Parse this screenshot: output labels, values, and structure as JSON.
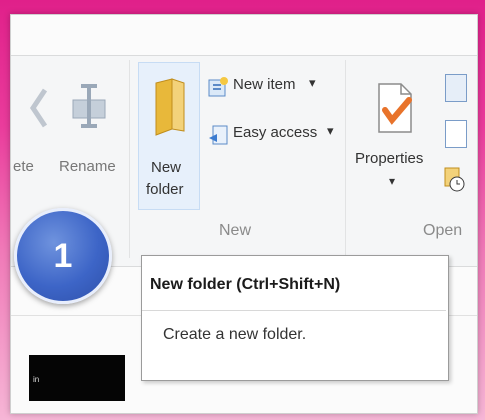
{
  "ribbon": {
    "delete_label": "ete",
    "rename_label": "Rename",
    "new_folder_label_line1": "New",
    "new_folder_label_line2": "folder",
    "new_item_label": "New item",
    "easy_access_label": "Easy access",
    "dropdown_caret": "▾",
    "properties_label": "Properties",
    "group_new_label": "New",
    "group_open_label": "Open"
  },
  "tooltip": {
    "title": "New folder (Ctrl+Shift+N)",
    "description": "Create a new folder."
  },
  "step_badge": "1",
  "black_box_text": "in",
  "colors": {
    "background_gradient_top": "#e0208a",
    "badge_blue": "#3d65c7",
    "checkmark_orange": "#e8732b",
    "folder_yellow": "#e8b83a"
  }
}
